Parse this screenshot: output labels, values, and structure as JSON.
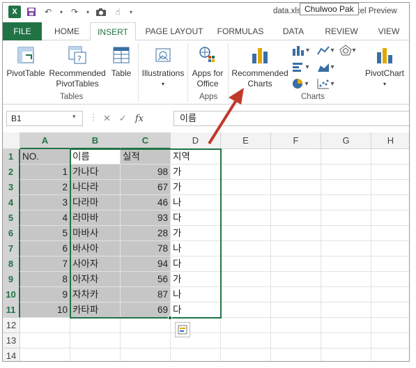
{
  "window": {
    "title": "data.xlsx - Microsoft Excel Preview",
    "user": "Chulwoo Pak"
  },
  "tabs": [
    "FILE",
    "HOME",
    "INSERT",
    "PAGE LAYOUT",
    "FORMULAS",
    "DATA",
    "REVIEW",
    "VIEW"
  ],
  "ribbon": {
    "pivottable": "PivotTable",
    "recommended_pivot_line1": "Recommended",
    "recommended_pivot_line2": "PivotTables",
    "table": "Table",
    "illustrations": "Illustrations",
    "apps_line1": "Apps for",
    "apps_line2": "Office",
    "recommended_charts_line1": "Recommended",
    "recommended_charts_line2": "Charts",
    "pivotchart": "PivotChart",
    "group_tables": "Tables",
    "group_apps": "Apps",
    "group_charts": "Charts"
  },
  "formula_bar": {
    "name_box": "B1",
    "fx": "fx",
    "value": "이름"
  },
  "columns": [
    "A",
    "B",
    "C",
    "D",
    "E",
    "F",
    "G",
    "H"
  ],
  "rows": [
    "1",
    "2",
    "3",
    "4",
    "5",
    "6",
    "7",
    "8",
    "9",
    "10",
    "11",
    "12",
    "13",
    "14"
  ],
  "sheet": {
    "header": [
      "NO.",
      "이름",
      "실적",
      "지역"
    ],
    "data": [
      [
        "1",
        "가나다",
        "98",
        "가"
      ],
      [
        "2",
        "나다라",
        "67",
        "가"
      ],
      [
        "3",
        "다라마",
        "46",
        "나"
      ],
      [
        "4",
        "라마바",
        "93",
        "다"
      ],
      [
        "5",
        "마바사",
        "28",
        "가"
      ],
      [
        "6",
        "바사아",
        "78",
        "나"
      ],
      [
        "7",
        "사아자",
        "94",
        "다"
      ],
      [
        "8",
        "아자차",
        "56",
        "가"
      ],
      [
        "9",
        "자차카",
        "87",
        "나"
      ],
      [
        "10",
        "카타파",
        "69",
        "다"
      ]
    ]
  },
  "colors": {
    "excel_green": "#217346",
    "selection_shade": "#c6c6c6",
    "annotation_arrow": "#c0392b"
  }
}
